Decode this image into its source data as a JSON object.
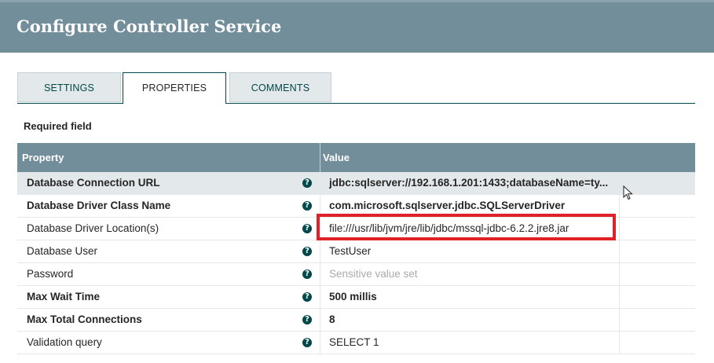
{
  "dialog": {
    "title": "Configure Controller Service"
  },
  "tabs": [
    {
      "label": "SETTINGS",
      "active": false
    },
    {
      "label": "PROPERTIES",
      "active": true
    },
    {
      "label": "COMMENTS",
      "active": false
    }
  ],
  "required_label": "Required field",
  "grid": {
    "columns": {
      "property": "Property",
      "value": "Value"
    },
    "rows": [
      {
        "name": "Database Connection URL",
        "value": "jdbc:sqlserver://192.168.1.201:1433;databaseName=ty...",
        "required": true,
        "selected": true,
        "help_icon": "?"
      },
      {
        "name": "Database Driver Class Name",
        "value": "com.microsoft.sqlserver.jdbc.SQLServerDriver",
        "required": true,
        "selected": false,
        "help_icon": "?"
      },
      {
        "name": "Database Driver Location(s)",
        "value": "file:///usr/lib/jvm/jre/lib/jdbc/mssql-jdbc-6.2.2.jre8.jar",
        "required": false,
        "selected": false,
        "help_icon": "?"
      },
      {
        "name": "Database User",
        "value": "TestUser",
        "required": false,
        "selected": false,
        "help_icon": "?"
      },
      {
        "name": "Password",
        "value": "Sensitive value set",
        "required": false,
        "selected": false,
        "muted": true,
        "help_icon": "?"
      },
      {
        "name": "Max Wait Time",
        "value": "500 millis",
        "required": true,
        "selected": false,
        "help_icon": "?"
      },
      {
        "name": "Max Total Connections",
        "value": "8",
        "required": true,
        "selected": false,
        "help_icon": "?"
      },
      {
        "name": "Validation query",
        "value": "SELECT 1",
        "required": false,
        "selected": false,
        "help_icon": "?"
      }
    ]
  },
  "colors": {
    "titlebar": "#728e9b",
    "accent": "#004849",
    "highlight_box": "#e02128"
  }
}
